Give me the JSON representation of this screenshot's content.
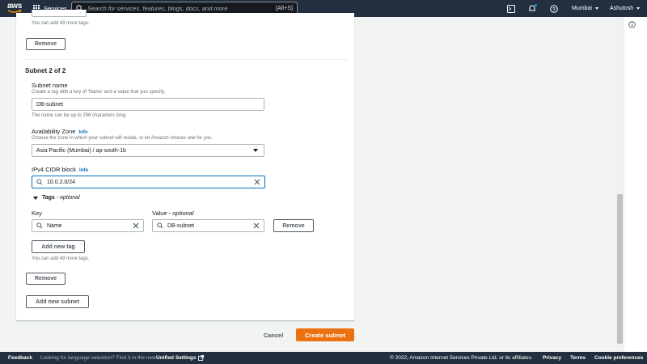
{
  "nav": {
    "logo_text": "aws",
    "services_label": "Services",
    "search_placeholder": "Search for services, features, blogs, docs, and more",
    "search_shortcut": "[Alt+S]",
    "region": "Mumbai",
    "user": "Ashutosh"
  },
  "tags_prev": {
    "more_tags_hint": "You can add 49 more tags.",
    "remove_label": "Remove"
  },
  "subnet": {
    "heading": "Subnet 2 of 2",
    "name_label": "Subnet name",
    "name_hint": "Create a tag with a key of 'Name' and a value that you specify.",
    "name_value": "DB-subnet",
    "name_limit": "The name can be up to 256 characters long.",
    "az_label": "Availability Zone",
    "az_info": "Info",
    "az_hint": "Choose the zone in which your subnet will reside, or let Amazon choose one for you.",
    "az_value": "Asia Pacific (Mumbai) / ap-south-1b",
    "cidr_label": "IPv4 CIDR block",
    "cidr_info": "Info",
    "cidr_value": "10.0.2.0/24"
  },
  "tags": {
    "section_title": "Tags",
    "section_optional": "- optional",
    "key_label": "Key",
    "value_label": "Value",
    "value_optional": "- optional",
    "key_value": "Name",
    "value_value": "DB-subnet",
    "row_remove": "Remove",
    "add_tag": "Add new tag",
    "more_tags_hint": "You can add 49 more tags.",
    "remove_label": "Remove",
    "add_subnet": "Add new subnet"
  },
  "actions": {
    "cancel": "Cancel",
    "create": "Create subnet"
  },
  "footer": {
    "feedback": "Feedback",
    "language_prompt": "Looking for language selection? Find it in the new",
    "unified_settings": "Unified Settings",
    "copyright": "© 2022, Amazon Internet Services Private Ltd. or its affiliates.",
    "privacy": "Privacy",
    "terms": "Terms",
    "cookies": "Cookie preferences"
  },
  "colors": {
    "nav_bg": "#232f3e",
    "primary": "#ec7211",
    "link": "#0073bb"
  }
}
